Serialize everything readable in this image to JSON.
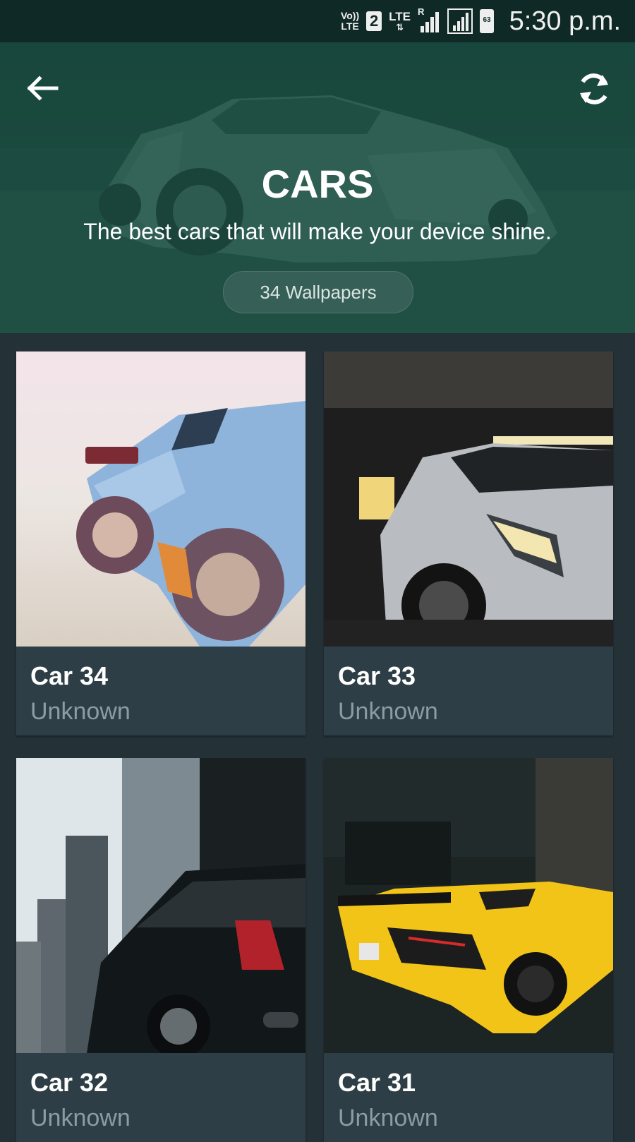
{
  "status_bar": {
    "volte_top": "Vo))",
    "volte_bottom": "LTE",
    "sim_slot": "2",
    "lte": "LTE",
    "roaming": "R",
    "battery_level": "63",
    "time": "5:30 p.m."
  },
  "header": {
    "back_icon": "arrow-left-icon",
    "refresh_icon": "refresh-icon",
    "title": "CARS",
    "subtitle": "The best cars that will make your device shine.",
    "count_label": "34 Wallpapers"
  },
  "wallpapers": [
    {
      "name": "Car 34",
      "author": "Unknown"
    },
    {
      "name": "Car 33",
      "author": "Unknown"
    },
    {
      "name": "Car 32",
      "author": "Unknown"
    },
    {
      "name": "Car 31",
      "author": "Unknown"
    }
  ],
  "colors": {
    "background": "#243238",
    "card": "#2e3e46",
    "header_tint": "#1f4c42",
    "status_bar": "#0f2a26",
    "author_text": "#8d9ca3"
  }
}
